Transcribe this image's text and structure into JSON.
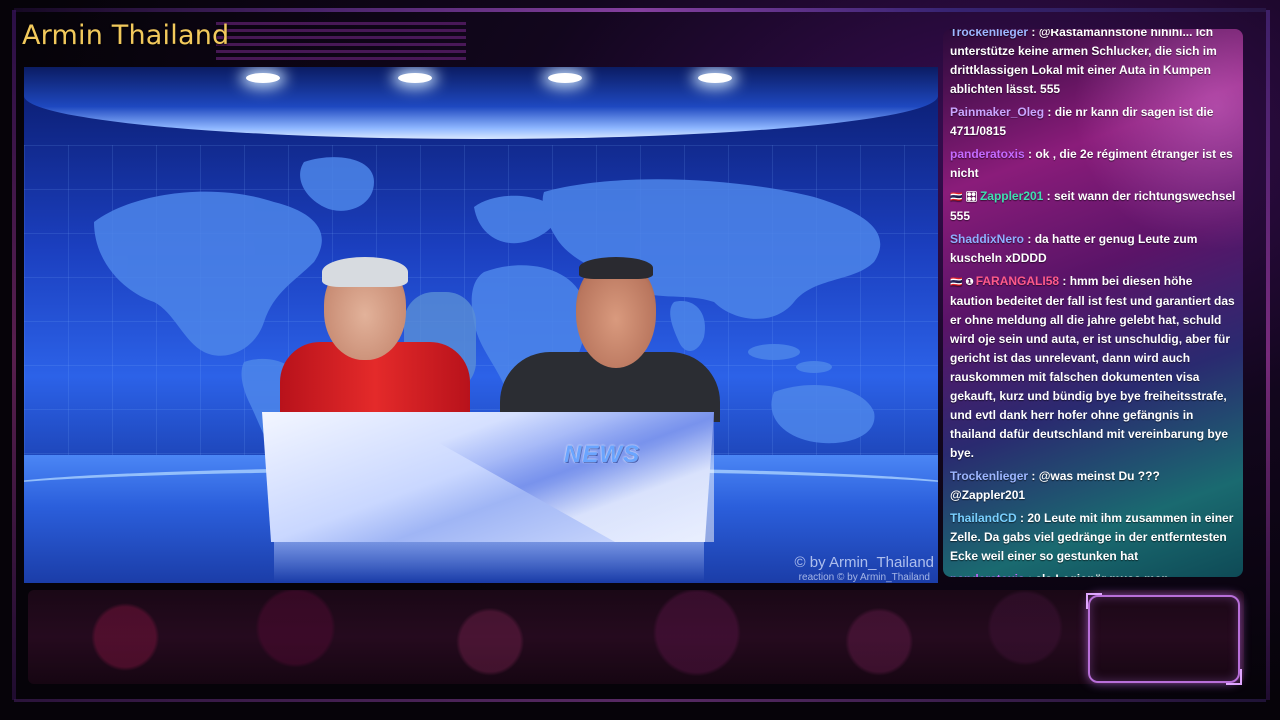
{
  "title": "Armin Thailand",
  "video": {
    "desk_label": "NEWS",
    "watermark": "© by Armin_Thailand",
    "reaction_watermark": "reaction  © by Armin_Thailand"
  },
  "chat": {
    "messages": [
      {
        "user": "Trockenlieger",
        "color": "#9db6ff",
        "badge": "",
        "text": ": @Rastamannstone hihihi... Ich unterstütze keine armen Schlucker, die sich im drittklassigen Lokal mit einer Auta in Kumpen ablichten lässt. 555"
      },
      {
        "user": "Painmaker_Oleg",
        "color": "#c9a6ff",
        "badge": "",
        "text": ": die nr kann dir sagen ist die 4711/0815"
      },
      {
        "user": "panderatoxis",
        "color": "#c46bff",
        "badge": "",
        "text": ": ok , die 2e régiment étranger ist es nicht"
      },
      {
        "user": "Zappler201",
        "color": "#3fe0b0",
        "badge": "🇹🇭 🎛",
        "text": ": seit wann der richtungswechsel 555"
      },
      {
        "user": "ShaddixNero",
        "color": "#8fb0ff",
        "badge": "",
        "text": ": da hatte er genug Leute zum kuscheln xDDDD"
      },
      {
        "user": "FARANGALI58",
        "color": "#ff5a8a",
        "badge": "🇹🇭 ❶",
        "text": ": hmm bei diesen höhe kaution bedeitet der fall ist fest und garantiert das er ohne meldung all die jahre gelebt hat, schuld wird oje sein und auta, er ist unschuldig, aber für gericht ist das unrelevant, dann wird auch rauskommen mit falschen dokumenten visa gekauft, kurz und bündig bye bye freiheitsstrafe, und evtl dank herr hofer ohne gefängnis in thailand dafür deutschland mit vereinbarung bye bye."
      },
      {
        "user": "Trockenlieger",
        "color": "#9db6ff",
        "badge": "",
        "text": ": @was meinst Du ??? @Zappler201"
      },
      {
        "user": "ThailandCD",
        "color": "#7ad0ff",
        "badge": "",
        "text": ": 20 Leute mit ihm zusammen in einer Zelle. Da gabs viel gedränge in der entferntesten Ecke weil einer so gestunken hat"
      },
      {
        "user": "panderatoxis",
        "color": "#c46bff",
        "badge": "",
        "text": ": als Legionär muss man französisch können, der labbert einen Scheissreck"
      }
    ]
  }
}
